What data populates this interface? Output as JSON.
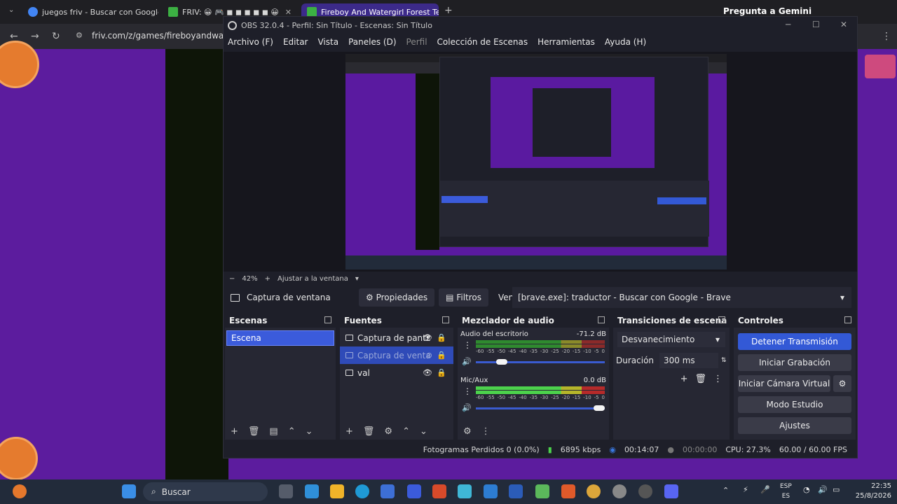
{
  "browser": {
    "tabs": [
      {
        "title": "juegos friv - Buscar con Google"
      },
      {
        "title": "FRIV: 😀 🎮 ◼ ◼ ◼ ◼ ◼ 😀"
      },
      {
        "title": "Fireboy And Watergirl Forest Te"
      }
    ],
    "gemini": "Pregunta a Gemini",
    "url": "friv.com/z/games/fireboyandwatergi"
  },
  "obs": {
    "title": "OBS 32.0.4 - Perfil: Sin Título - Escenas: Sin Título",
    "menu": [
      "Archivo (F)",
      "Editar",
      "Vista",
      "Paneles (D)",
      "Perfil",
      "Colección de Escenas",
      "Herramientas",
      "Ayuda (H)"
    ],
    "zoom": {
      "value": "42%",
      "fit": "Ajustar a la ventana"
    },
    "source_bar": {
      "capture": "Captura de ventana",
      "properties": "Propiedades",
      "filters": "Filtros",
      "window_label": "Ventana",
      "window_value": "[brave.exe]: traductor - Buscar con Google - Brave"
    },
    "scenes": {
      "title": "Escenas",
      "items": [
        "Escena"
      ]
    },
    "sources": {
      "title": "Fuentes",
      "items": [
        "Captura de pantz",
        "Captura de venta",
        "val"
      ]
    },
    "mixer": {
      "title": "Mezclador de audio",
      "channels": [
        {
          "name": "Audio del escritorio",
          "db": "-71.2 dB",
          "volume": 0.2
        },
        {
          "name": "Mic/Aux",
          "db": "0.0 dB",
          "volume": 1.0
        }
      ],
      "scale": [
        "-60",
        "-55",
        "-50",
        "-45",
        "-40",
        "-35",
        "-30",
        "-25",
        "-20",
        "-15",
        "-10",
        "-5",
        "0"
      ]
    },
    "transitions": {
      "title": "Transiciones de escena",
      "type": "Desvanecimiento",
      "duration_label": "Duración",
      "duration": "300 ms"
    },
    "controls": {
      "title": "Controles",
      "stop_stream": "Detener Transmisión",
      "start_rec": "Iniciar Grabación",
      "start_vcam": "Iniciar Cámara Virtual",
      "studio": "Modo Estudio",
      "settings": "Ajustes"
    },
    "status": {
      "dropped": "Fotogramas Perdidos 0 (0.0%)",
      "bitrate": "6895 kbps",
      "stream_time": "00:14:07",
      "rec_time": "00:00:00",
      "cpu": "CPU: 27.3%",
      "fps": "60.00 / 60.00 FPS"
    }
  },
  "taskbar": {
    "search": "Buscar",
    "lang_1": "ESP",
    "lang_2": "ES",
    "time": "22:35",
    "date": "25/8/2026"
  },
  "colors": {
    "accent": "#3359d6",
    "page_bg": "#5c1c9e",
    "obs_bg": "#1e1f29"
  }
}
